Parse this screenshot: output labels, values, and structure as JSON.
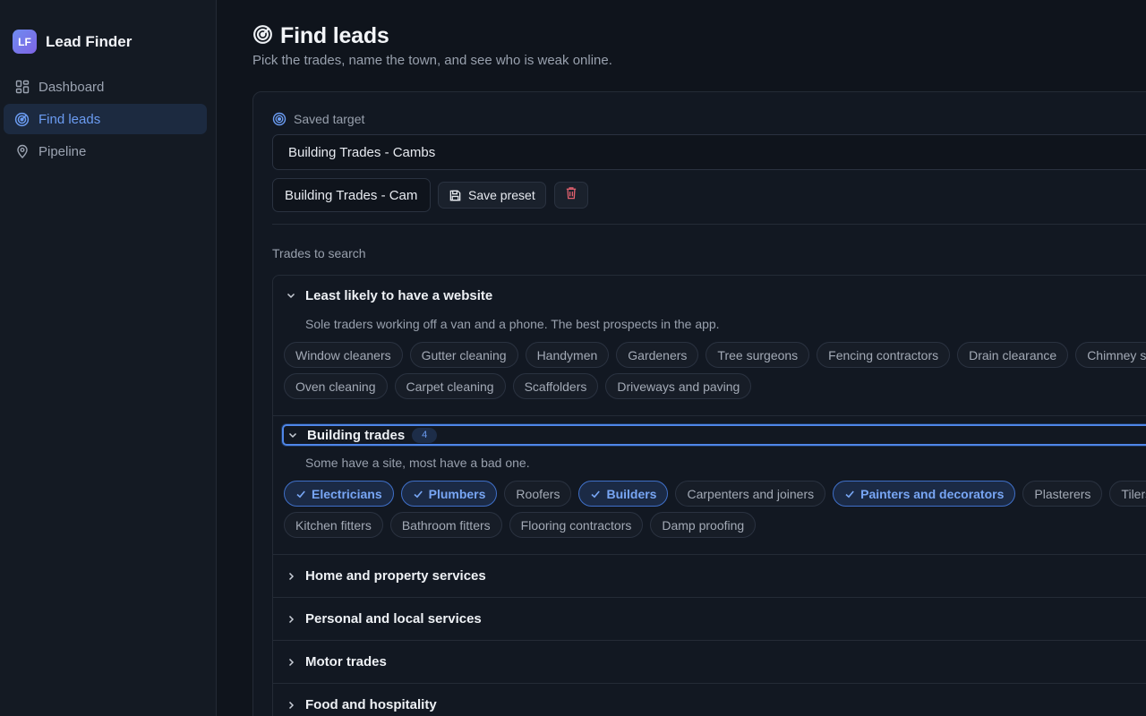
{
  "brand": {
    "badge": "LF",
    "name": "Lead Finder"
  },
  "nav": [
    {
      "label": "Dashboard",
      "icon": "dashboard-icon",
      "active": false
    },
    {
      "label": "Find leads",
      "icon": "radar-icon",
      "active": true
    },
    {
      "label": "Pipeline",
      "icon": "map-pin-icon",
      "active": false
    }
  ],
  "page": {
    "title": "Find leads",
    "subtitle": "Pick the trades, name the town, and see who is weak online."
  },
  "target": {
    "label": "Saved target",
    "selected": "Building Trades - Cambs",
    "preset_name": "Building Trades - Cam",
    "save_label": "Save preset"
  },
  "trades": {
    "label": "Trades to search",
    "groups": [
      {
        "title": "Least likely to have a website",
        "description": "Sole traders working off a van and a phone. The best prospects in the app.",
        "count": "",
        "expanded": true,
        "chips": [
          {
            "label": "Window cleaners",
            "selected": false
          },
          {
            "label": "Gutter cleaning",
            "selected": false
          },
          {
            "label": "Handymen",
            "selected": false
          },
          {
            "label": "Gardeners",
            "selected": false
          },
          {
            "label": "Tree surgeons",
            "selected": false
          },
          {
            "label": "Fencing contractors",
            "selected": false
          },
          {
            "label": "Drain clearance",
            "selected": false
          },
          {
            "label": "Chimney sw",
            "selected": false
          },
          {
            "label": "Oven cleaning",
            "selected": false
          },
          {
            "label": "Carpet cleaning",
            "selected": false
          },
          {
            "label": "Scaffolders",
            "selected": false
          },
          {
            "label": "Driveways and paving",
            "selected": false
          }
        ]
      },
      {
        "title": "Building trades",
        "description": "Some have a site, most have a bad one.",
        "count": "4",
        "expanded": true,
        "chips": [
          {
            "label": "Electricians",
            "selected": true
          },
          {
            "label": "Plumbers",
            "selected": true
          },
          {
            "label": "Roofers",
            "selected": false
          },
          {
            "label": "Builders",
            "selected": true
          },
          {
            "label": "Carpenters and joiners",
            "selected": false
          },
          {
            "label": "Painters and decorators",
            "selected": true
          },
          {
            "label": "Plasterers",
            "selected": false
          },
          {
            "label": "Tilers",
            "selected": false
          },
          {
            "label": "Kitchen fitters",
            "selected": false
          },
          {
            "label": "Bathroom fitters",
            "selected": false
          },
          {
            "label": "Flooring contractors",
            "selected": false
          },
          {
            "label": "Damp proofing",
            "selected": false
          }
        ]
      },
      {
        "title": "Home and property services",
        "description": "",
        "count": "",
        "expanded": false,
        "chips": []
      },
      {
        "title": "Personal and local services",
        "description": "",
        "count": "",
        "expanded": false,
        "chips": []
      },
      {
        "title": "Motor trades",
        "description": "",
        "count": "",
        "expanded": false,
        "chips": []
      },
      {
        "title": "Food and hospitality",
        "description": "",
        "count": "",
        "expanded": false,
        "chips": []
      }
    ]
  },
  "colors": {
    "accent": "#6b9cf2",
    "danger": "#e0606e",
    "background": "#0f141c"
  }
}
